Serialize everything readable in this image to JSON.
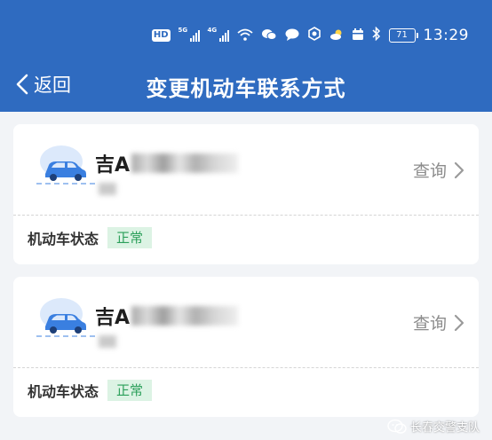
{
  "status_bar": {
    "network_hd": "HD",
    "signal_1_tag": "5G",
    "signal_2_tag": "4G",
    "battery": "71",
    "time": "13:29",
    "icons": [
      "hd-icon",
      "signal-5g-icon",
      "signal-4g-icon",
      "wifi-icon",
      "wechat-icon",
      "message-icon",
      "app-icon",
      "weather-icon",
      "calendar-icon",
      "bluetooth-icon",
      "battery-icon"
    ]
  },
  "nav": {
    "back_label": "返回",
    "title": "变更机动车联系方式"
  },
  "vehicles": [
    {
      "plate_prefix": "吉A",
      "query_label": "查询",
      "status_label": "机动车状态",
      "status_value": "正常"
    },
    {
      "plate_prefix": "吉A",
      "query_label": "查询",
      "status_label": "机动车状态",
      "status_value": "正常"
    }
  ],
  "watermark": {
    "text": "长春交警支队"
  },
  "colors": {
    "header_bg": "#2f6bc0",
    "page_bg": "#f2f4f7",
    "status_green": "#2b9f5a",
    "status_green_bg": "#dcf3e4",
    "car_blue": "#3a7fe0"
  }
}
